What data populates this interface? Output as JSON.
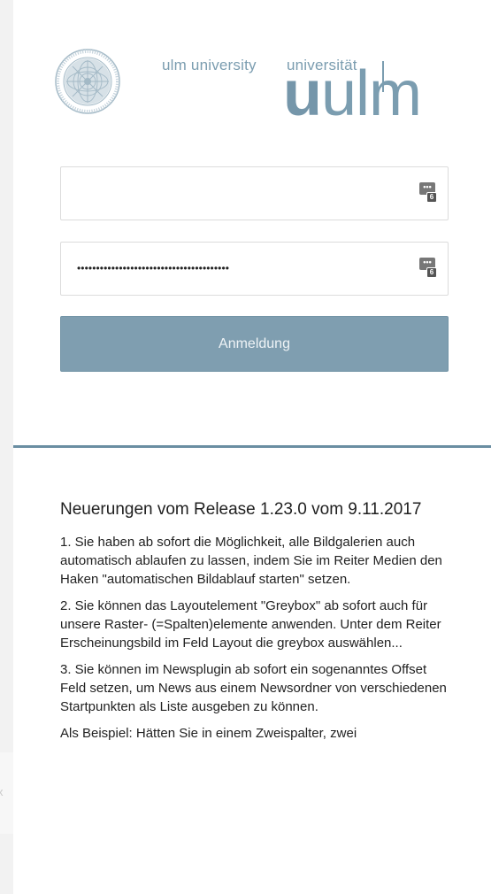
{
  "logo": {
    "english_name": "ulm university",
    "german_name": "universität",
    "wordmark_bold": "u",
    "wordmark_thin": "ulm",
    "seal_icon": "university-seal-icon",
    "color": "#7b9db0"
  },
  "login": {
    "username_value": "",
    "password_mask": "••••••••••••••••••••••••••••••••••••••••",
    "password_manager_icon": "key-manager-icon",
    "password_manager_badge": "6",
    "submit_label": "Anmeldung",
    "button_color": "#7f9eb0"
  },
  "news": {
    "title": "Neuerungen vom Release 1.23.0 vom 9.11.2017",
    "paragraphs": [
      "1. Sie haben ab sofort die Möglichkeit, alle Bildgalerien auch automatisch ablaufen zu lassen, indem Sie im Reiter Medien den Haken \"automatischen Bildablauf starten\" setzen.",
      "2. Sie können das Layoutelement \"Greybox\" ab sofort auch für unsere Raster- (=Spalten)elemente anwenden. Unter dem Reiter Erscheinungsbild im Feld Layout die greybox auswählen...",
      "3. Sie können im Newsplugin ab sofort ein sogenanntes Offset Feld setzen, um News aus einem Newsordner von verschiedenen Startpunkten als Liste ausgeben zu können."
    ],
    "truncated_line": "Als Beispiel: Hätten Sie in einem Zweispalter, zwei"
  },
  "background": {
    "left_mark": "x"
  }
}
